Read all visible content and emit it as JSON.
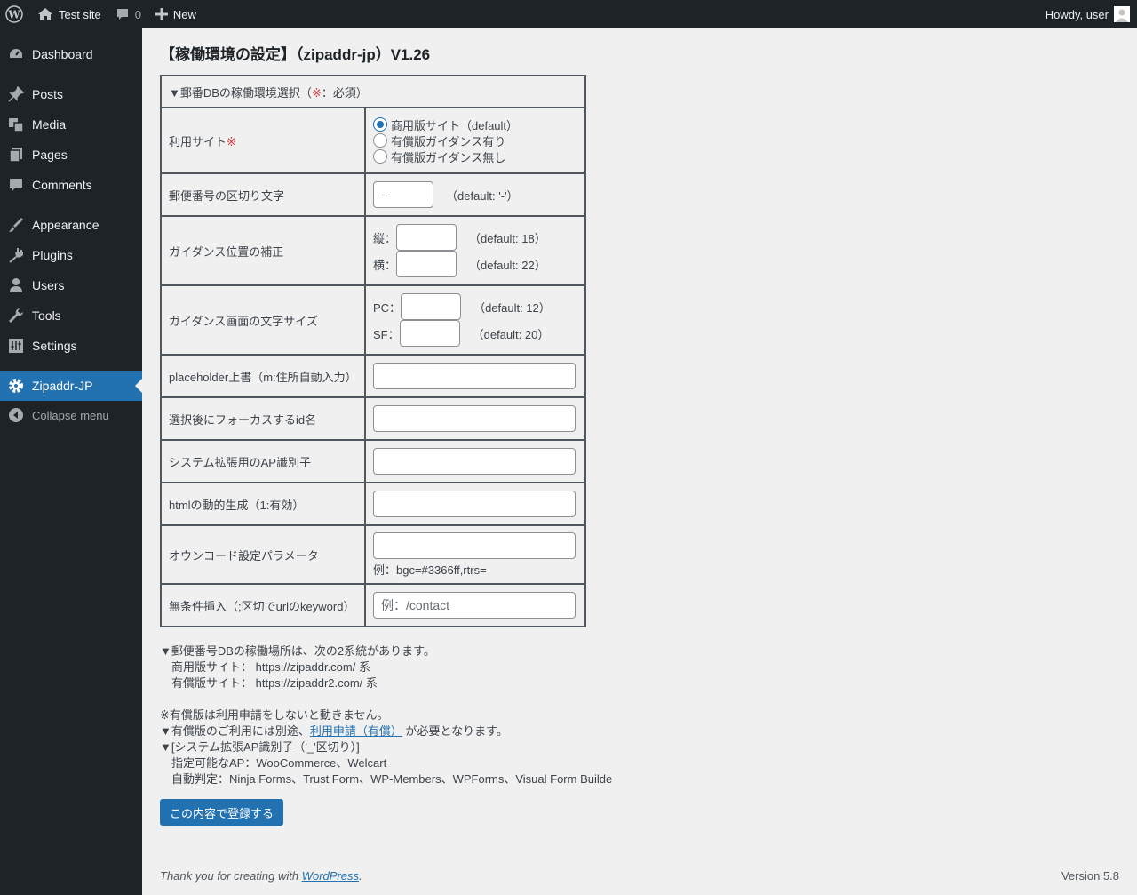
{
  "adminbar": {
    "site_name": "Test site",
    "comments_count": "0",
    "new_label": "New",
    "howdy": "Howdy, user"
  },
  "sidebar": {
    "items": [
      {
        "label": "Dashboard",
        "icon": "dashboard-icon"
      },
      {
        "label": "Posts",
        "icon": "pin-icon"
      },
      {
        "label": "Media",
        "icon": "media-icon"
      },
      {
        "label": "Pages",
        "icon": "pages-icon"
      },
      {
        "label": "Comments",
        "icon": "comment-icon"
      },
      {
        "label": "Appearance",
        "icon": "brush-icon"
      },
      {
        "label": "Plugins",
        "icon": "plug-icon"
      },
      {
        "label": "Users",
        "icon": "user-icon"
      },
      {
        "label": "Tools",
        "icon": "wrench-icon"
      },
      {
        "label": "Settings",
        "icon": "settings-icon"
      },
      {
        "label": "Zipaddr-JP",
        "icon": "gear-icon",
        "current": true
      }
    ],
    "collapse_label": "Collapse menu"
  },
  "page": {
    "title": "【稼働環境の設定】（zipaddr-jp）V1.26"
  },
  "form": {
    "header_prefix": "▼郵番DBの稼働環境選択（",
    "header_req": "※",
    "header_suffix": "：必須）",
    "site": {
      "label": "利用サイト",
      "req": "※",
      "options": [
        "商用版サイト（default）",
        "有償版ガイダンス有り",
        "有償版ガイダンス無し"
      ],
      "selected": 0
    },
    "delimiter": {
      "label": "郵便番号の区切り文字",
      "value": "-",
      "default": "（default: '-'）"
    },
    "guide_pos": {
      "label": "ガイダンス位置の補正",
      "v_label": "縦：",
      "v_default": "（default: 18）",
      "h_label": "横：",
      "h_default": "（default: 22）"
    },
    "font_size": {
      "label": "ガイダンス画面の文字サイズ",
      "pc_label": "PC：",
      "pc_default": "（default: 12）",
      "sf_label": "SF：",
      "sf_default": "（default: 20）"
    },
    "placeholder": {
      "label": "placeholder上書（m:住所自動入力）",
      "value": ""
    },
    "focus_id": {
      "label": "選択後にフォーカスするid名",
      "value": ""
    },
    "ap_id": {
      "label": "システム拡張用のAP識別子",
      "value": ""
    },
    "dynamic_html": {
      "label": "htmlの動的生成（1:有効）",
      "value": ""
    },
    "own_code": {
      "label": "オウンコード設定パラメータ",
      "value": "",
      "example": "例：bgc=#3366ff,rtrs="
    },
    "unconditional": {
      "label": "無条件挿入（;区切でurlのkeyword）",
      "placeholder": "例：/contact"
    }
  },
  "notes": {
    "line1": "▼郵便番号DBの稼働場所は、次の2系統があります。",
    "line2": "商用版サイト： https://zipaddr.com/ 系",
    "line3": "有償版サイト： https://zipaddr2.com/ 系",
    "line4": "※有償版は利用申請をしないと動きません。",
    "line5_pre": "▼有償版のご利用には別途、",
    "line5_link": "利用申請（有償）",
    "line5_post": "が必要となります。",
    "line6": "▼[システム拡張AP識別子（'_'区切り）]",
    "line7": "指定可能なAP：WooCommerce、Welcart",
    "line8": "自動判定：Ninja Forms、Trust Form、WP-Members、WPForms、Visual Form Builde"
  },
  "submit_label": "この内容で登録する",
  "footer": {
    "thanks": "Thank you for creating with ",
    "wp_link": "WordPress",
    "period": ".",
    "version": "Version 5.8"
  },
  "colors": {
    "accent": "#2271b1",
    "adminbar_bg": "#1d2327",
    "required": "#d63638"
  }
}
